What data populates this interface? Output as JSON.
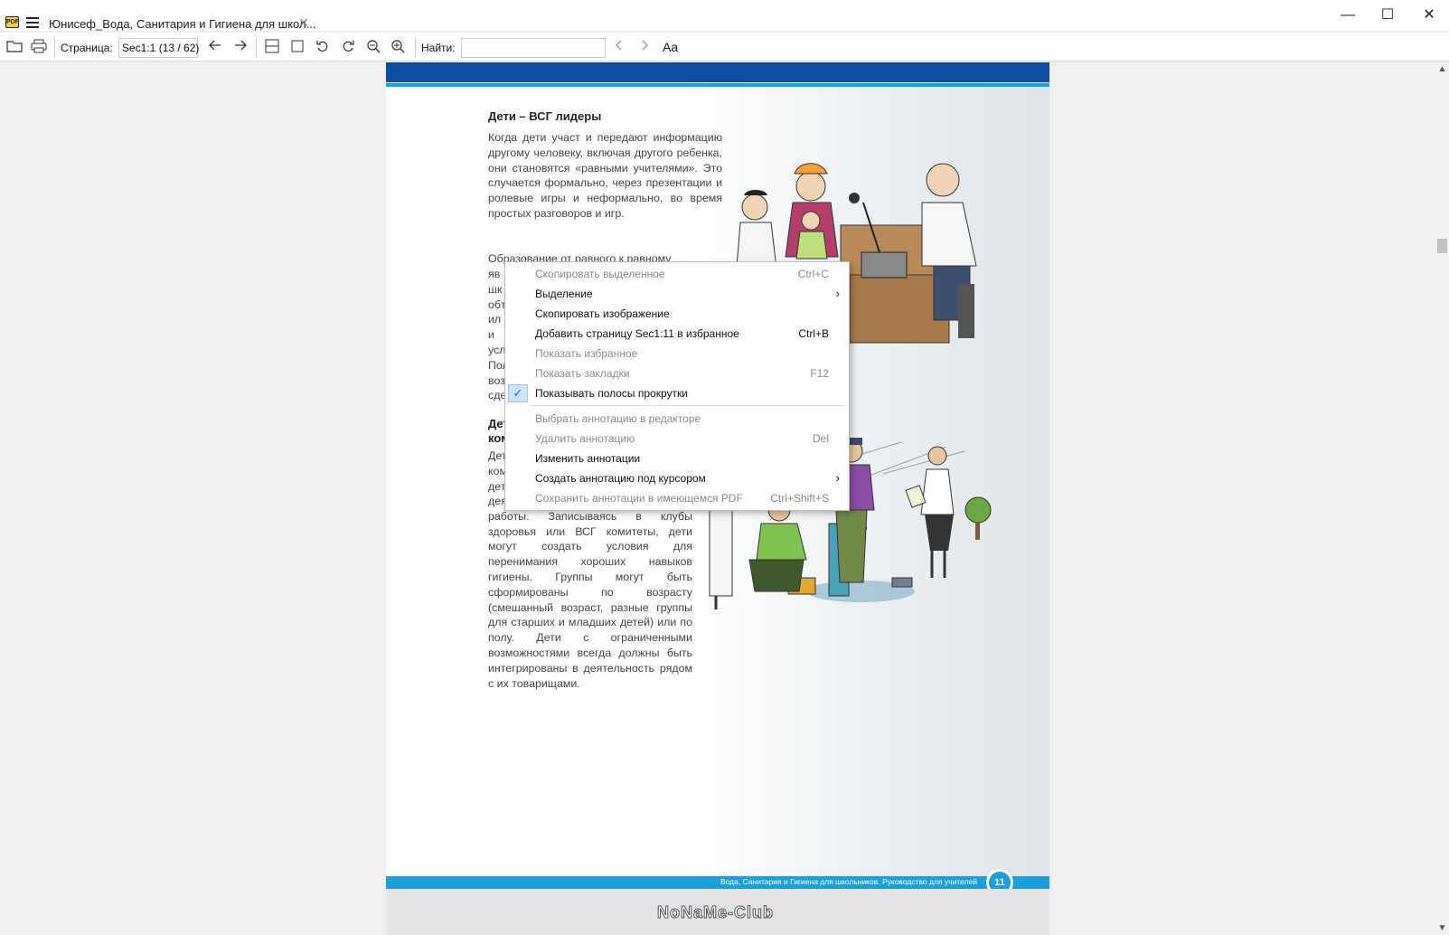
{
  "window": {
    "tab_title": "Юнисеф_Вода, Санитария и Гигиена для школ...",
    "app_icon_text": "PDF",
    "minimize_glyph": "—",
    "maximize_glyph": "☐",
    "close_glyph": "✕",
    "tab_close_glyph": "✕"
  },
  "toolbar": {
    "page_label": "Страница:",
    "page_value": "Sec1:1  (13 / 62)",
    "find_label": "Найти:",
    "find_value": "",
    "font_toggle": "Aa"
  },
  "document": {
    "section1_heading": "Дети – ВСГ лидеры",
    "section1_para1": "Когда дети участ и передают информацию другому человеку, включая другого ребенка, они становятся «равными учителями». Это случается формально, через презентации и ролевые игры и неформально, во время простых разговоров и игр.",
    "section1_para2_visible": "Образование от равного к равному",
    "section1_para2_fragments": [
      "яв",
      "шк",
      "обт",
      "ил",
      "и",
      "усл",
      "Пол",
      "воз",
      "сде"
    ],
    "section2_heading_fragments": [
      "Дет",
      "ком"
    ],
    "section2_para_fragments": [
      "Дет",
      "ком",
      "дет"
    ],
    "section2_para_visible": "деятельность и отслеживать ход работы. Записываясь в клубы здоровья или ВСГ комитеты, дети могут создать условия для перенимания хороших навыков гигиены. Группы могут быть сформированы по возрасту (смешанный возраст, разные группы для старших и младших детей) или по полу. Дети с ограниченными возможностями всегда должны быть интегрированы в деятельность рядом с их товарищами.",
    "footer_text": "Вода, Санитария и Гигиена для школьников. Руководство для учителей",
    "page_number": "11",
    "watermark": "NoNaMe-Club"
  },
  "context_menu": {
    "items": [
      {
        "label": "Скопировать выделенное",
        "shortcut": "Ctrl+C",
        "enabled": false
      },
      {
        "label": "Выделение",
        "shortcut": "",
        "enabled": true,
        "submenu": true
      },
      {
        "label": "Скопировать изображение",
        "shortcut": "",
        "enabled": true
      },
      {
        "label": "Добавить страницу Sec1:11 в избранное",
        "shortcut": "Ctrl+B",
        "enabled": true
      },
      {
        "label": "Показать избранное",
        "shortcut": "",
        "enabled": false
      },
      {
        "label": "Показать закладки",
        "shortcut": "F12",
        "enabled": false
      },
      {
        "label": "Показывать полосы прокрутки",
        "shortcut": "",
        "enabled": true,
        "checked": true
      },
      {
        "label": "Выбрать аннотацию в редакторе",
        "shortcut": "",
        "enabled": false
      },
      {
        "label": "Удалить аннотацию",
        "shortcut": "Del",
        "enabled": false
      },
      {
        "label": "Изменить аннотации",
        "shortcut": "",
        "enabled": true
      },
      {
        "label": "Создать аннотацию под курсором",
        "shortcut": "",
        "enabled": true,
        "submenu": true
      },
      {
        "label": "Сохранить аннотации в имеющемся PDF",
        "shortcut": "Ctrl+Shift+S",
        "enabled": false
      }
    ],
    "check_glyph": "✓",
    "submenu_glyph": "›"
  },
  "colors": {
    "page_header_blue": "#0d4ea0",
    "accent_cyan": "#1aa0dc",
    "menu_check_bg": "#cce4f7"
  }
}
